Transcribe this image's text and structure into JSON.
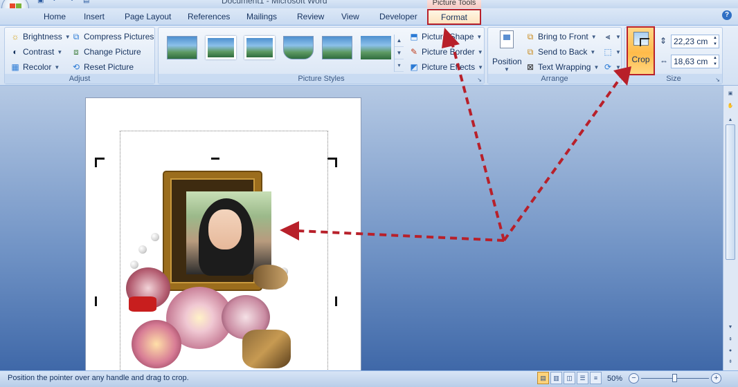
{
  "window": {
    "title": "Document1 - Microsoft Word",
    "contextual_title": "Picture Tools"
  },
  "tabs": [
    {
      "label": "Home"
    },
    {
      "label": "Insert"
    },
    {
      "label": "Page Layout"
    },
    {
      "label": "References"
    },
    {
      "label": "Mailings"
    },
    {
      "label": "Review"
    },
    {
      "label": "View"
    },
    {
      "label": "Developer"
    }
  ],
  "active_tab": {
    "label": "Format"
  },
  "ribbon": {
    "adjust": {
      "label": "Adjust",
      "brightness": "Brightness",
      "contrast": "Contrast",
      "recolor": "Recolor",
      "compress": "Compress Pictures",
      "change": "Change Picture",
      "reset": "Reset Picture"
    },
    "picture_styles": {
      "label": "Picture Styles",
      "shape": "Picture Shape",
      "border": "Picture Border",
      "effects": "Picture Effects"
    },
    "arrange": {
      "label": "Arrange",
      "position": "Position",
      "bring_front": "Bring to Front",
      "send_back": "Send to Back",
      "text_wrapping": "Text Wrapping"
    },
    "size": {
      "label": "Size",
      "crop": "Crop",
      "height": "22,23 cm",
      "width": "18,63 cm"
    }
  },
  "status": {
    "message": "Position the pointer over any handle and drag to crop.",
    "zoom": "50%",
    "zoom_level_fraction": 0.5
  },
  "colors": {
    "highlight_border": "#b8202a",
    "arrow": "#b8202a",
    "crop_active": "#ffbb4a"
  }
}
